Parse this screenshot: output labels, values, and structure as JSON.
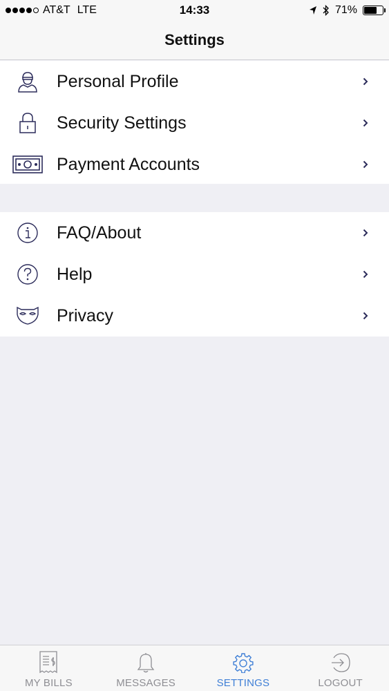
{
  "status_bar": {
    "carrier": "AT&T",
    "network": "LTE",
    "time": "14:33",
    "battery": "71%",
    "battery_level": 0.71
  },
  "nav": {
    "title": "Settings"
  },
  "groups": [
    {
      "items": [
        {
          "label": "Personal Profile",
          "icon": "person-icon"
        },
        {
          "label": "Security Settings",
          "icon": "lock-icon"
        },
        {
          "label": "Payment Accounts",
          "icon": "money-icon"
        }
      ]
    },
    {
      "items": [
        {
          "label": "FAQ/About",
          "icon": "info-icon"
        },
        {
          "label": "Help",
          "icon": "question-icon"
        },
        {
          "label": "Privacy",
          "icon": "mask-icon"
        }
      ]
    }
  ],
  "tabs": [
    {
      "label": "MY BILLS",
      "icon": "receipt-icon",
      "active": false
    },
    {
      "label": "MESSAGES",
      "icon": "bell-icon",
      "active": false
    },
    {
      "label": "SETTINGS",
      "icon": "gear-icon",
      "active": true
    },
    {
      "label": "LOGOUT",
      "icon": "logout-icon",
      "active": false
    }
  ],
  "colors": {
    "icon": "#2b2b5a",
    "accent": "#3f7fd6",
    "inactive": "#8e8e93",
    "background": "#efeff4"
  }
}
